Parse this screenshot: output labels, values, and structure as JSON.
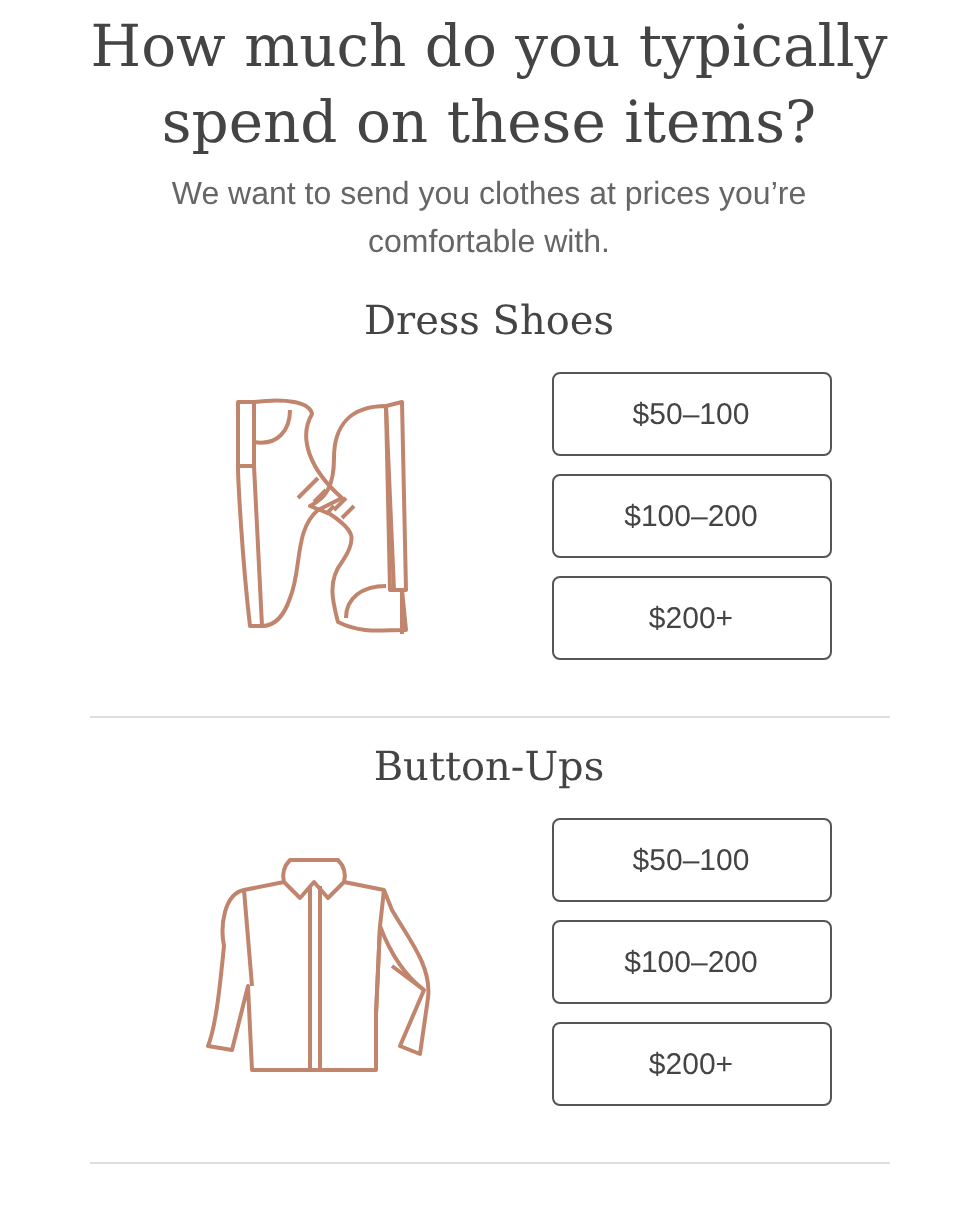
{
  "title": "How much do you typically spend on these items?",
  "subtitle": "We want to send you clothes at prices you’re comfortable with.",
  "categories": [
    {
      "name": "Dress Shoes",
      "kind": "shoes",
      "options": [
        "$50–100",
        "$100–200",
        "$200+"
      ]
    },
    {
      "name": "Button-Ups",
      "kind": "shirt",
      "options": [
        "$50–100",
        "$100–200",
        "$200+"
      ]
    }
  ]
}
